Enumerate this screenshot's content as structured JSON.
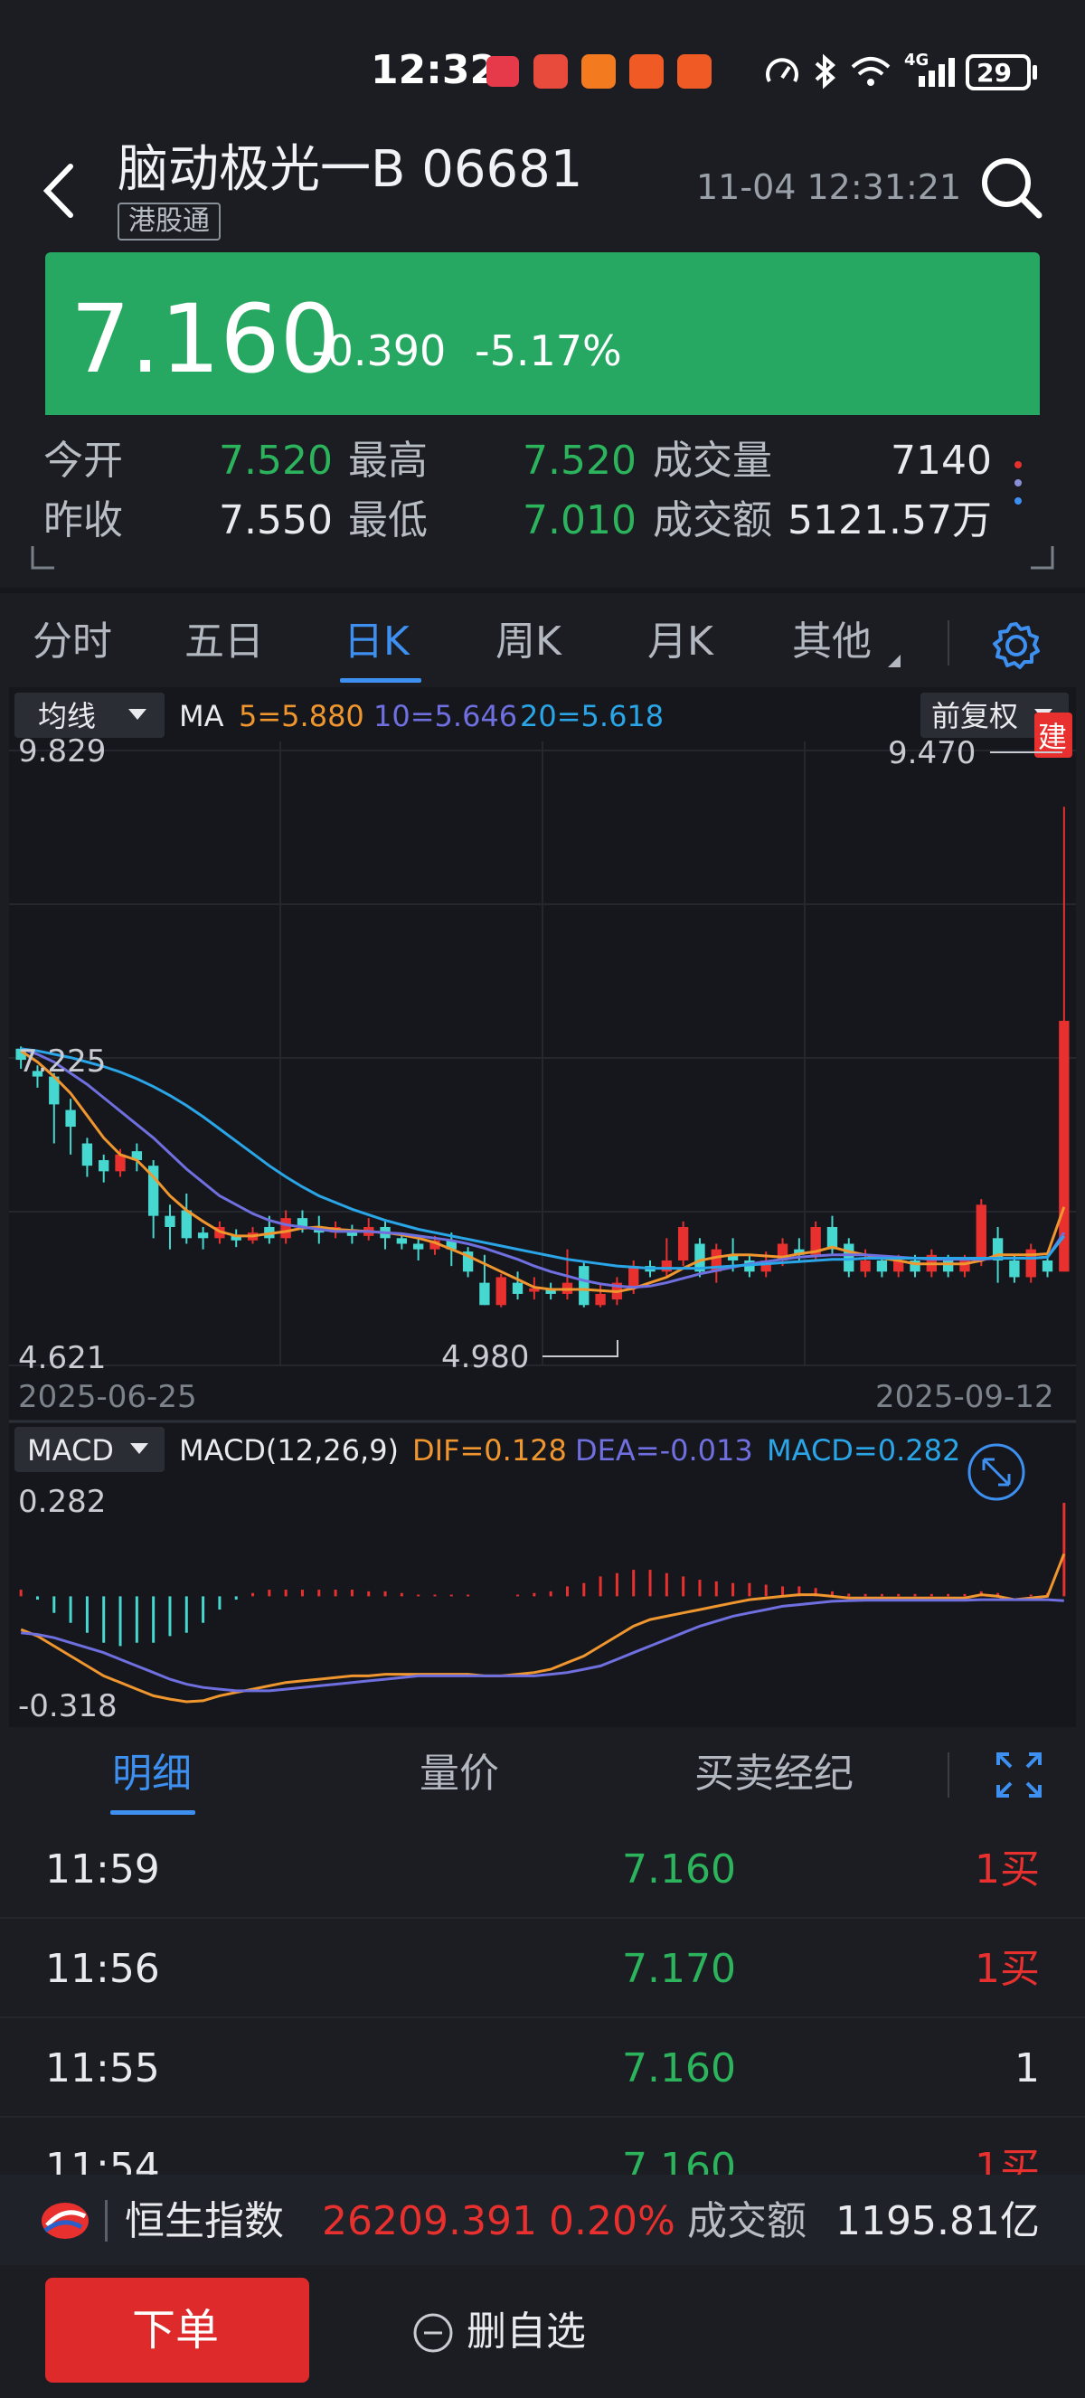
{
  "status_bar": {
    "time": "12:32",
    "network": "4G",
    "battery": "29"
  },
  "header": {
    "title": "脑动极光一B 06681",
    "badge": "港股通",
    "datetime": "11-04 12:31:21"
  },
  "quote": {
    "price": "7.160",
    "change": "-0.390",
    "change_pct": "-5.17%"
  },
  "stats": {
    "open_label": "今开",
    "open": "7.520",
    "high_label": "最高",
    "high": "7.520",
    "volume_label": "成交量",
    "volume": "7140",
    "prev_close_label": "昨收",
    "prev_close": "7.550",
    "low_label": "最低",
    "low": "7.010",
    "turnover_label": "成交额",
    "turnover": "5121.57万"
  },
  "period_tabs": [
    {
      "label": "分时"
    },
    {
      "label": "五日"
    },
    {
      "label": "日K"
    },
    {
      "label": "周K"
    },
    {
      "label": "月K"
    },
    {
      "label": "其他"
    }
  ],
  "chart_controls": {
    "indicator_select": "均线",
    "ma_label": "MA",
    "ma5": "5=5.880",
    "ma10": "10=5.646",
    "ma20": "20=5.618",
    "adjust_select": "前复权",
    "build_badge": "建",
    "macd_select": "MACD",
    "macd_label": "MACD(12,26,9)",
    "dif": "DIF=0.128",
    "dea": "DEA=-0.013",
    "macd_val": "MACD=0.282"
  },
  "chart_data": {
    "type": "candlestick",
    "y_high_label": "9.829",
    "y_mid_label": "7.225",
    "y_low_label": "4.621",
    "max_marker": "9.470",
    "min_marker": "4.980",
    "x_start_label": "2025-06-25",
    "x_end_label": "2025-09-12",
    "ylim": [
      4.621,
      9.829
    ],
    "candles": [
      [
        7.3,
        7.2,
        7.32,
        7.12
      ],
      [
        7.1,
        7.05,
        7.15,
        6.95
      ],
      [
        7.05,
        6.8,
        7.08,
        6.45
      ],
      [
        6.75,
        6.6,
        6.85,
        6.35
      ],
      [
        6.45,
        6.25,
        6.5,
        6.15
      ],
      [
        6.3,
        6.2,
        6.35,
        6.1
      ],
      [
        6.2,
        6.35,
        6.4,
        6.15
      ],
      [
        6.38,
        6.3,
        6.45,
        6.2
      ],
      [
        6.25,
        5.8,
        6.3,
        5.6
      ],
      [
        5.8,
        5.7,
        5.9,
        5.5
      ],
      [
        5.85,
        5.6,
        6.0,
        5.55
      ],
      [
        5.65,
        5.6,
        5.7,
        5.5
      ],
      [
        5.6,
        5.7,
        5.75,
        5.55
      ],
      [
        5.62,
        5.58,
        5.68,
        5.52
      ],
      [
        5.58,
        5.65,
        5.7,
        5.55
      ],
      [
        5.7,
        5.6,
        5.8,
        5.55
      ],
      [
        5.6,
        5.78,
        5.85,
        5.55
      ],
      [
        5.78,
        5.7,
        5.85,
        5.65
      ],
      [
        5.7,
        5.65,
        5.8,
        5.55
      ],
      [
        5.65,
        5.7,
        5.75,
        5.6
      ],
      [
        5.68,
        5.62,
        5.72,
        5.55
      ],
      [
        5.62,
        5.7,
        5.78,
        5.58
      ],
      [
        5.7,
        5.6,
        5.75,
        5.5
      ],
      [
        5.6,
        5.55,
        5.65,
        5.5
      ],
      [
        5.55,
        5.5,
        5.6,
        5.4
      ],
      [
        5.5,
        5.58,
        5.62,
        5.45
      ],
      [
        5.58,
        5.5,
        5.65,
        5.35
      ],
      [
        5.48,
        5.3,
        5.52,
        5.25
      ],
      [
        5.2,
        5.0,
        5.45,
        5.0
      ],
      [
        5.0,
        5.25,
        5.28,
        4.98
      ],
      [
        5.2,
        5.1,
        5.3,
        5.05
      ],
      [
        5.12,
        5.15,
        5.25,
        5.05
      ],
      [
        5.15,
        5.1,
        5.2,
        5.05
      ],
      [
        5.1,
        5.2,
        5.5,
        5.05
      ],
      [
        5.35,
        5.0,
        5.4,
        4.98
      ],
      [
        5.0,
        5.1,
        5.2,
        4.98
      ],
      [
        5.05,
        5.2,
        5.25,
        5.0
      ],
      [
        5.15,
        5.35,
        5.4,
        5.1
      ],
      [
        5.35,
        5.3,
        5.4,
        5.25
      ],
      [
        5.3,
        5.4,
        5.6,
        5.25
      ],
      [
        5.4,
        5.7,
        5.75,
        5.35
      ],
      [
        5.55,
        5.3,
        5.6,
        5.25
      ],
      [
        5.3,
        5.5,
        5.55,
        5.2
      ],
      [
        5.45,
        5.4,
        5.6,
        5.3
      ],
      [
        5.4,
        5.3,
        5.45,
        5.25
      ],
      [
        5.3,
        5.4,
        5.48,
        5.25
      ],
      [
        5.4,
        5.55,
        5.6,
        5.35
      ],
      [
        5.5,
        5.45,
        5.6,
        5.4
      ],
      [
        5.45,
        5.7,
        5.75,
        5.4
      ],
      [
        5.7,
        5.5,
        5.8,
        5.45
      ],
      [
        5.55,
        5.3,
        5.6,
        5.25
      ],
      [
        5.3,
        5.4,
        5.5,
        5.25
      ],
      [
        5.4,
        5.3,
        5.45,
        5.25
      ],
      [
        5.3,
        5.4,
        5.45,
        5.25
      ],
      [
        5.4,
        5.3,
        5.45,
        5.25
      ],
      [
        5.3,
        5.45,
        5.5,
        5.25
      ],
      [
        5.4,
        5.3,
        5.45,
        5.25
      ],
      [
        5.3,
        5.4,
        5.45,
        5.25
      ],
      [
        5.4,
        5.9,
        5.95,
        5.35
      ],
      [
        5.6,
        5.4,
        5.7,
        5.2
      ],
      [
        5.4,
        5.25,
        5.45,
        5.2
      ],
      [
        5.25,
        5.5,
        5.55,
        5.2
      ],
      [
        5.4,
        5.3,
        5.45,
        5.25
      ],
      [
        5.3,
        7.55,
        9.47,
        5.3
      ]
    ],
    "ma5": [
      7.28,
      7.18,
      7.05,
      6.9,
      6.7,
      6.5,
      6.35,
      6.3,
      6.15,
      5.98,
      5.85,
      5.75,
      5.66,
      5.62,
      5.62,
      5.64,
      5.66,
      5.69,
      5.7,
      5.68,
      5.67,
      5.66,
      5.65,
      5.63,
      5.6,
      5.56,
      5.5,
      5.44,
      5.37,
      5.3,
      5.23,
      5.16,
      5.14,
      5.14,
      5.14,
      5.13,
      5.12,
      5.15,
      5.2,
      5.25,
      5.33,
      5.4,
      5.43,
      5.45,
      5.45,
      5.44,
      5.43,
      5.46,
      5.48,
      5.52,
      5.48,
      5.45,
      5.42,
      5.4,
      5.37,
      5.37,
      5.37,
      5.37,
      5.4,
      5.45,
      5.45,
      5.45,
      5.46,
      5.88
    ],
    "ma10": [
      7.3,
      7.25,
      7.18,
      7.08,
      6.98,
      6.86,
      6.74,
      6.62,
      6.5,
      6.36,
      6.22,
      6.1,
      5.98,
      5.9,
      5.82,
      5.76,
      5.72,
      5.7,
      5.68,
      5.66,
      5.66,
      5.66,
      5.65,
      5.64,
      5.62,
      5.6,
      5.58,
      5.55,
      5.51,
      5.46,
      5.41,
      5.35,
      5.3,
      5.26,
      5.22,
      5.19,
      5.17,
      5.16,
      5.17,
      5.2,
      5.24,
      5.28,
      5.31,
      5.34,
      5.37,
      5.39,
      5.41,
      5.43,
      5.44,
      5.45,
      5.45,
      5.45,
      5.44,
      5.43,
      5.42,
      5.41,
      5.41,
      5.41,
      5.41,
      5.42,
      5.42,
      5.42,
      5.43,
      5.65
    ],
    "ma20": [
      7.3,
      7.28,
      7.25,
      7.22,
      7.18,
      7.14,
      7.09,
      7.03,
      6.96,
      6.88,
      6.79,
      6.69,
      6.58,
      6.47,
      6.36,
      6.25,
      6.15,
      6.06,
      5.98,
      5.92,
      5.86,
      5.81,
      5.76,
      5.72,
      5.68,
      5.65,
      5.62,
      5.59,
      5.56,
      5.53,
      5.5,
      5.47,
      5.44,
      5.41,
      5.39,
      5.37,
      5.35,
      5.34,
      5.33,
      5.33,
      5.33,
      5.33,
      5.34,
      5.35,
      5.36,
      5.37,
      5.38,
      5.39,
      5.4,
      5.41,
      5.41,
      5.42,
      5.42,
      5.42,
      5.42,
      5.42,
      5.42,
      5.42,
      5.42,
      5.42,
      5.42,
      5.42,
      5.43,
      5.62
    ],
    "macd_ylim": [
      -0.318,
      0.282
    ],
    "macd_high_label": "0.282",
    "macd_low_label": "-0.318",
    "dif": [
      -0.1,
      -0.12,
      -0.15,
      -0.18,
      -0.21,
      -0.24,
      -0.26,
      -0.28,
      -0.3,
      -0.31,
      -0.318,
      -0.315,
      -0.3,
      -0.29,
      -0.28,
      -0.27,
      -0.26,
      -0.255,
      -0.25,
      -0.245,
      -0.24,
      -0.24,
      -0.235,
      -0.235,
      -0.235,
      -0.235,
      -0.235,
      -0.235,
      -0.24,
      -0.24,
      -0.235,
      -0.23,
      -0.22,
      -0.2,
      -0.18,
      -0.15,
      -0.12,
      -0.09,
      -0.07,
      -0.06,
      -0.05,
      -0.04,
      -0.03,
      -0.02,
      -0.01,
      -0.005,
      0.0,
      0.005,
      0.005,
      0.0,
      -0.005,
      -0.005,
      -0.005,
      -0.005,
      -0.005,
      -0.005,
      -0.005,
      -0.005,
      0.005,
      0.0,
      -0.01,
      -0.005,
      0.0,
      0.128
    ],
    "dea": [
      -0.11,
      -0.115,
      -0.125,
      -0.14,
      -0.155,
      -0.17,
      -0.19,
      -0.21,
      -0.23,
      -0.25,
      -0.265,
      -0.275,
      -0.28,
      -0.285,
      -0.285,
      -0.285,
      -0.28,
      -0.275,
      -0.27,
      -0.265,
      -0.26,
      -0.255,
      -0.25,
      -0.245,
      -0.24,
      -0.24,
      -0.24,
      -0.24,
      -0.24,
      -0.24,
      -0.24,
      -0.24,
      -0.235,
      -0.23,
      -0.22,
      -0.21,
      -0.19,
      -0.17,
      -0.15,
      -0.13,
      -0.11,
      -0.09,
      -0.075,
      -0.06,
      -0.05,
      -0.04,
      -0.03,
      -0.025,
      -0.02,
      -0.015,
      -0.013,
      -0.012,
      -0.012,
      -0.012,
      -0.012,
      -0.012,
      -0.012,
      -0.012,
      -0.01,
      -0.01,
      -0.01,
      -0.01,
      -0.01,
      -0.013
    ],
    "hist": [
      0.02,
      -0.01,
      -0.05,
      -0.08,
      -0.11,
      -0.14,
      -0.15,
      -0.14,
      -0.14,
      -0.12,
      -0.11,
      -0.08,
      -0.04,
      -0.01,
      0.01,
      0.02,
      0.02,
      0.02,
      0.02,
      0.02,
      0.02,
      0.015,
      0.015,
      0.01,
      0.005,
      0.005,
      0.005,
      0.005,
      0.0,
      0.0,
      0.005,
      0.01,
      0.015,
      0.03,
      0.04,
      0.06,
      0.07,
      0.08,
      0.08,
      0.07,
      0.06,
      0.05,
      0.045,
      0.04,
      0.04,
      0.035,
      0.03,
      0.03,
      0.025,
      0.015,
      0.008,
      0.007,
      0.007,
      0.007,
      0.007,
      0.007,
      0.007,
      0.007,
      0.015,
      0.01,
      0.0,
      0.005,
      0.01,
      0.282
    ]
  },
  "bottom_tabs": [
    {
      "label": "明细"
    },
    {
      "label": "量价"
    },
    {
      "label": "买卖经纪"
    }
  ],
  "trades": [
    {
      "time": "11:59",
      "price": "7.160",
      "qty": "1买"
    },
    {
      "time": "11:56",
      "price": "7.170",
      "qty": "1买"
    },
    {
      "time": "11:55",
      "price": "7.160",
      "qty": "1"
    },
    {
      "time": "11:54",
      "price": "7.160",
      "qty": "1买"
    }
  ],
  "index_bar": {
    "name": "恒生指数",
    "value": "26209.391",
    "pct": "0.20%",
    "turnover_label": "成交额",
    "turnover": "1195.81亿"
  },
  "actions": {
    "order_label": "下单",
    "unwatch_label": "删自选"
  },
  "colors": {
    "up": "#e8302f",
    "down": "#46d8d0",
    "ma5": "#f0962e",
    "ma10": "#6f6fe0",
    "ma20": "#2aa6e8",
    "accent": "#3d8ff0",
    "price_bg": "#27a862"
  }
}
